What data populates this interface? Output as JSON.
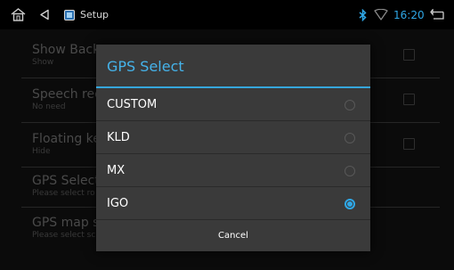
{
  "status_bar": {
    "title": "Setup",
    "time": "16:20",
    "icons": [
      "home-icon",
      "back-icon",
      "app-icon",
      "bluetooth-icon",
      "wifi-icon",
      "return-icon"
    ]
  },
  "settings": {
    "items": [
      {
        "title": "Show Back",
        "subtitle": "Show"
      },
      {
        "title": "Speech reco",
        "subtitle": "No need"
      },
      {
        "title": "Floating key",
        "subtitle": "Hide"
      },
      {
        "title": "GPS Select",
        "subtitle": "Please select ro"
      },
      {
        "title": "GPS map st",
        "subtitle": "Please select sc"
      }
    ]
  },
  "dialog": {
    "title": "GPS Select",
    "options": [
      {
        "label": "CUSTOM",
        "selected": false
      },
      {
        "label": "KLD",
        "selected": false
      },
      {
        "label": "MX",
        "selected": false
      },
      {
        "label": "IGO",
        "selected": true
      }
    ],
    "cancel_label": "Cancel"
  },
  "colors": {
    "accent": "#2fa7e6",
    "dialog_bg": "#3a3a3a",
    "screen_bg": "#0b0b0b"
  }
}
